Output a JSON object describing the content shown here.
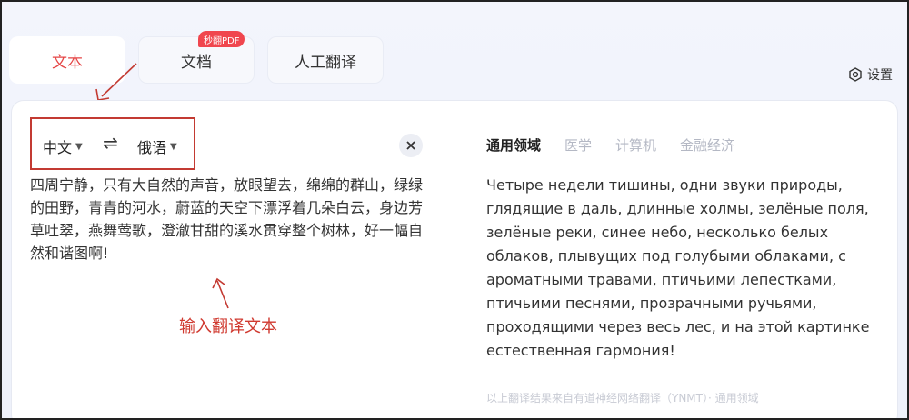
{
  "tabs": [
    {
      "label": "文本",
      "active": true
    },
    {
      "label": "文档",
      "badge": "秒翻PDF"
    },
    {
      "label": "人工翻译"
    }
  ],
  "settings": {
    "label": "设置",
    "icon": "gear-icon"
  },
  "source": {
    "language": "中文",
    "swap_icon": "swap-icon",
    "text": "四周宁静，只有大自然的声音，放眼望去，绵绵的群山，绿绿的田野，青青的河水，蔚蓝的天空下漂浮着几朵白云，身边芳草吐翠，燕舞莺歌，澄澈甘甜的溪水贯穿整个树林，好一幅自然和谐图啊!"
  },
  "target": {
    "language": "俄语",
    "domains": [
      "通用领域",
      "医学",
      "计算机",
      "金融经济"
    ],
    "active_domain": "通用领域",
    "text": "Четыре недели тишины, одни звуки природы, глядящие в даль, длинные холмы, зелёные поля, зелёные реки, синее небо, несколько белых облаков, плывущих под голубыми облаками, с ароматными травами, птичьими лепестками, птичьими песнями, прозрачными ручьями, проходящими через весь лес, и на этой картинке естественная гармония!",
    "footnote": "以上翻译结果来自有道神经网络翻译（YNMT）· 通用领域"
  },
  "annotation": {
    "label": "输入翻译文本",
    "color": "#d03a30"
  },
  "colors": {
    "accent_red": "#e54646",
    "badge": "#f0464e"
  }
}
